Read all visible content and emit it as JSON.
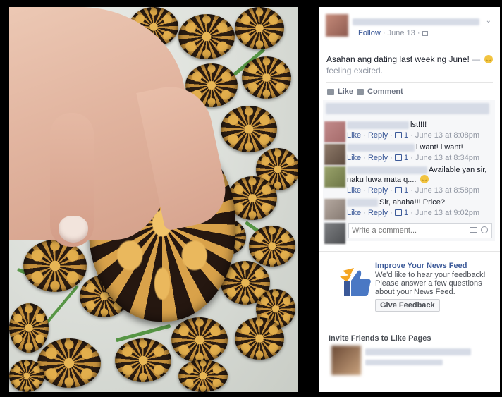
{
  "post": {
    "follow_label": "Follow",
    "date": "June 13",
    "separator": "·",
    "text": "Asahan ang dating last week ng June!",
    "feeling_dash": "—",
    "feeling_text": "feeling excited."
  },
  "actions": {
    "like_label": "Like",
    "comment_label": "Comment"
  },
  "comments": [
    {
      "text": "lst!!!!",
      "like_count": "1",
      "time": "June 13 at 8:08pm"
    },
    {
      "text": "i want! i want!",
      "like_count": "1",
      "time": "June 13 at 8:34pm"
    },
    {
      "text": "Available yan sir,",
      "text2": "naku luwa mata q....",
      "like_count": "1",
      "time": "June 13 at 8:58pm"
    },
    {
      "text": "Sir, ahaha!!! Price?",
      "like_count": "1",
      "time": "June 13 at 9:02pm"
    }
  ],
  "comment_links": {
    "like": "Like",
    "reply": "Reply",
    "dot": "·"
  },
  "composer": {
    "placeholder": "Write a comment..."
  },
  "feedback": {
    "title": "Improve Your News Feed",
    "description": "We'd like to hear your feedback! Please answer a few questions about your News Feed.",
    "button_label": "Give Feedback"
  },
  "invite": {
    "title": "Invite Friends to Like Pages"
  },
  "icons": [
    "globe-icon",
    "chevron-down-icon",
    "like-icon",
    "comment-icon",
    "thumbs-up-icon",
    "camera-icon",
    "emoji-icon",
    "feedback-thumbs-up-icon"
  ],
  "colors": {
    "link": "#3b5998",
    "meta": "#9197a3",
    "feed_bg": "#f6f7f9",
    "page_bg": "#000000"
  }
}
